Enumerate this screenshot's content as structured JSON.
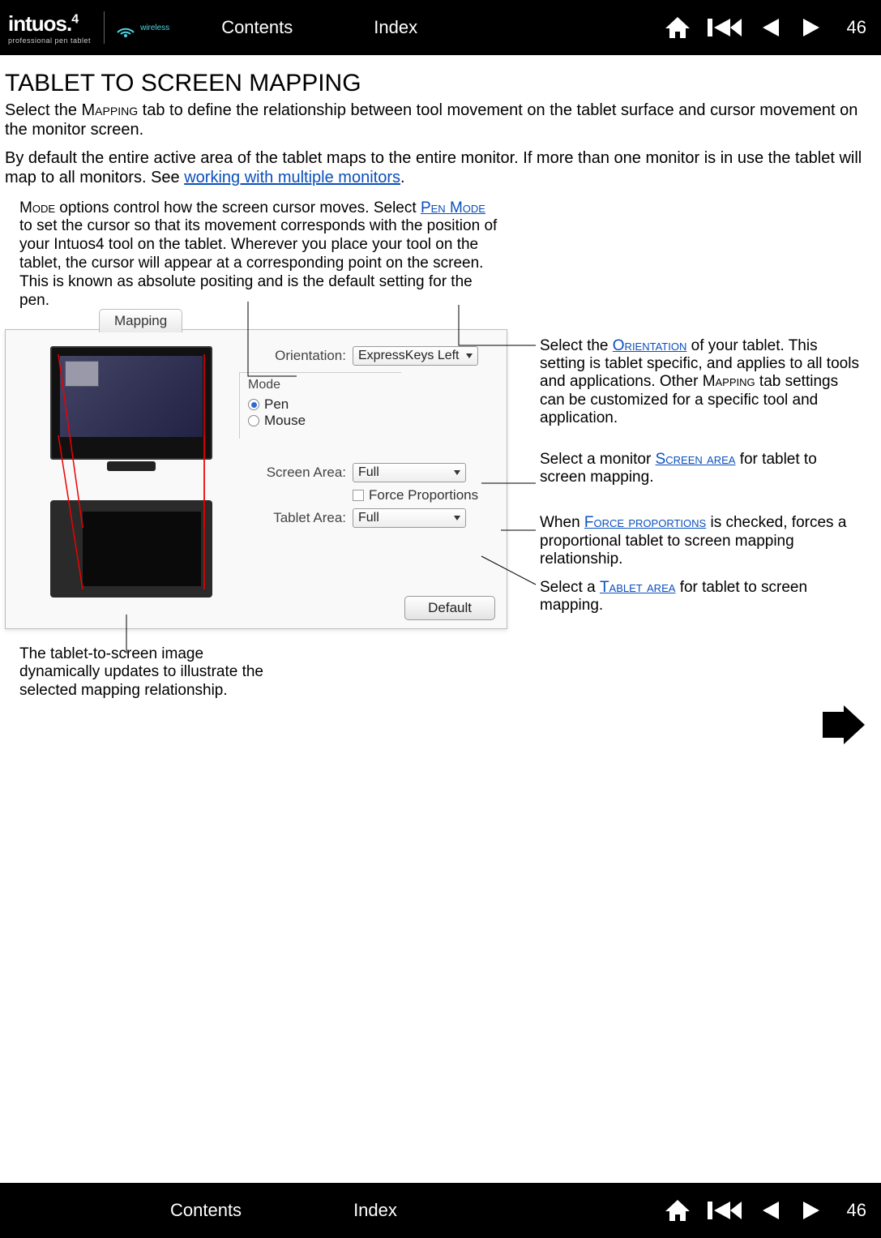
{
  "header": {
    "logo_main": "intuos.",
    "logo_suffix": "4",
    "logo_sub": "professional pen tablet",
    "wireless_label": "wireless",
    "nav_contents": "Contents",
    "nav_index": "Index",
    "page_number": "46"
  },
  "title": "TABLET TO SCREEN MAPPING",
  "p1_a": "Select the ",
  "p1_sc": "Mapping",
  "p1_b": " tab to define the relationship between tool movement on the tablet surface and cursor movement on the monitor screen.",
  "p2_a": "By default the entire active area of the tablet maps to the entire monitor.  If more than one monitor is in use the tablet will map to all monitors.  See ",
  "p2_link": "working with multiple monitors",
  "p2_b": ".",
  "mode_note_a": "Mode",
  "mode_note_b": " options control how the screen cursor moves.  Select ",
  "mode_note_link": "Pen Mode",
  "mode_note_c": " to set the cursor so that its movement corresponds with the position of your Intuos4 tool on the tablet.  Wherever you place your tool on the tablet, the cursor will appear at a corresponding point on the screen.  This is known as absolute positing and is the default setting for the pen.",
  "ui": {
    "tab_label": "Mapping",
    "orientation_label": "Orientation:",
    "orientation_value": "ExpressKeys Left",
    "mode_label": "Mode",
    "mode_pen": "Pen",
    "mode_mouse": "Mouse",
    "screen_area_label": "Screen Area:",
    "screen_area_value": "Full",
    "force_proportions_label": "Force Proportions",
    "tablet_area_label": "Tablet Area:",
    "tablet_area_value": "Full",
    "default_btn": "Default"
  },
  "call_orientation_a": "Select the ",
  "call_orientation_link": "Orientation",
  "call_orientation_b": " of your tablet.  This setting is tablet specific, and applies to all tools and applications.  Other ",
  "call_orientation_sc": "Mapping",
  "call_orientation_c": " tab settings can be customized for a specific tool and application.",
  "call_screen_a": "Select a monitor ",
  "call_screen_link": "Screen area",
  "call_screen_b": " for tablet to screen mapping.",
  "call_force_a": "When ",
  "call_force_link": "Force proportions",
  "call_force_b": " is checked, forces a proportional tablet to screen mapping relationship.",
  "call_tablet_a": "Select a ",
  "call_tablet_link": "Tablet area",
  "call_tablet_b": " for tablet to screen mapping.",
  "bottom_note": "The tablet-to-screen image dynamically updates to illustrate the selected mapping relationship.",
  "footer": {
    "nav_contents": "Contents",
    "nav_index": "Index",
    "page_number": "46"
  }
}
